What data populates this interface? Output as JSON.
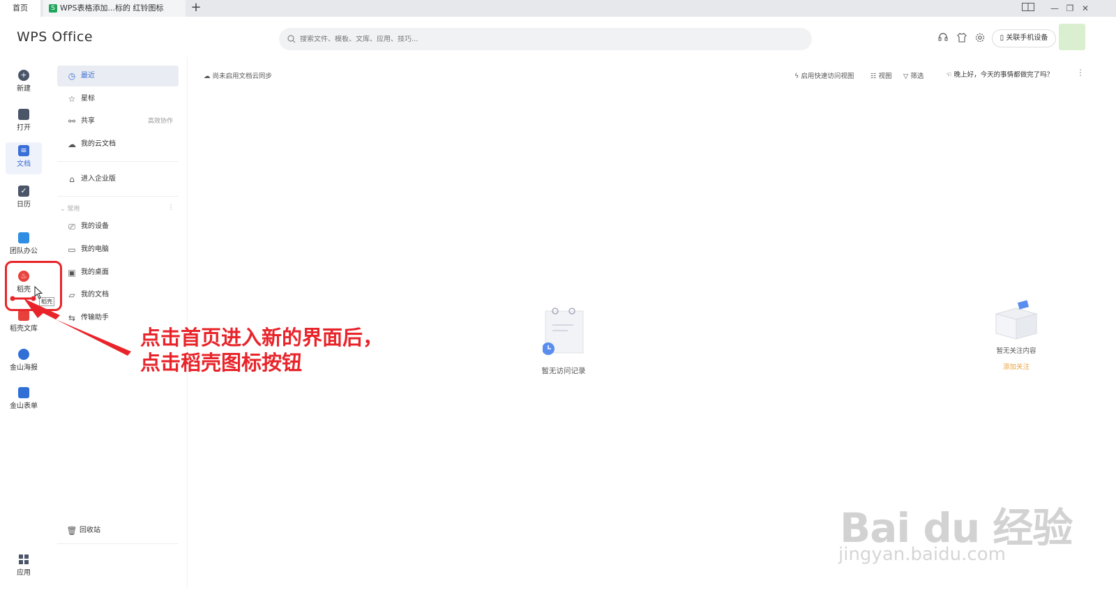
{
  "titlebar": {
    "home_tab": "首页",
    "doc_tab": "WPS表格添加...标的 红铃图标",
    "doc_tab_icon": "S"
  },
  "header": {
    "logo": "WPS Office",
    "search_placeholder": "搜索文件、模板、文库、应用、技巧...",
    "phone_button": "关联手机设备"
  },
  "rail": {
    "new": "新建",
    "open": "打开",
    "docs": "文档",
    "calendar": "日历",
    "team": "团队办公",
    "daoke": "稻壳",
    "daoke_library": "稻壳文库",
    "poster": "金山海报",
    "forms": "金山表单",
    "apps": "应用"
  },
  "sidebar": {
    "recent": "最近",
    "starred": "星标",
    "shared": "共享",
    "shared_extra": "高效协作",
    "cloud_docs": "我的云文档",
    "enterprise": "进入企业版",
    "common_section": "常用",
    "my_device": "我的设备",
    "my_computer": "我的电脑",
    "my_desktop": "我的桌面",
    "my_documents": "我的文档",
    "transfer_helper": "传输助手",
    "recycle_bin": "回收站"
  },
  "toolbar": {
    "cloud_status": "尚未启用文档云同步",
    "quick_view": "启用快速访问视图",
    "view": "视图",
    "filter": "筛选",
    "greeting": "晚上好，今天的事情都做完了吗？"
  },
  "empty": {
    "recent_text": "暂无访问记录",
    "follow_text": "暂无关注内容",
    "add_follow": "添加关注"
  },
  "annotation": {
    "line1": "点击首页进入新的界面后，",
    "line2": "点击稻壳图标按钮",
    "tooltip": "稻壳"
  },
  "watermark": {
    "brand": "Bai du 经验",
    "url": "jingyan.baidu.com"
  },
  "colors": {
    "accent": "#3b6fd8",
    "annotation_red": "#e8242a",
    "add_follow_orange": "#e6a23c"
  }
}
